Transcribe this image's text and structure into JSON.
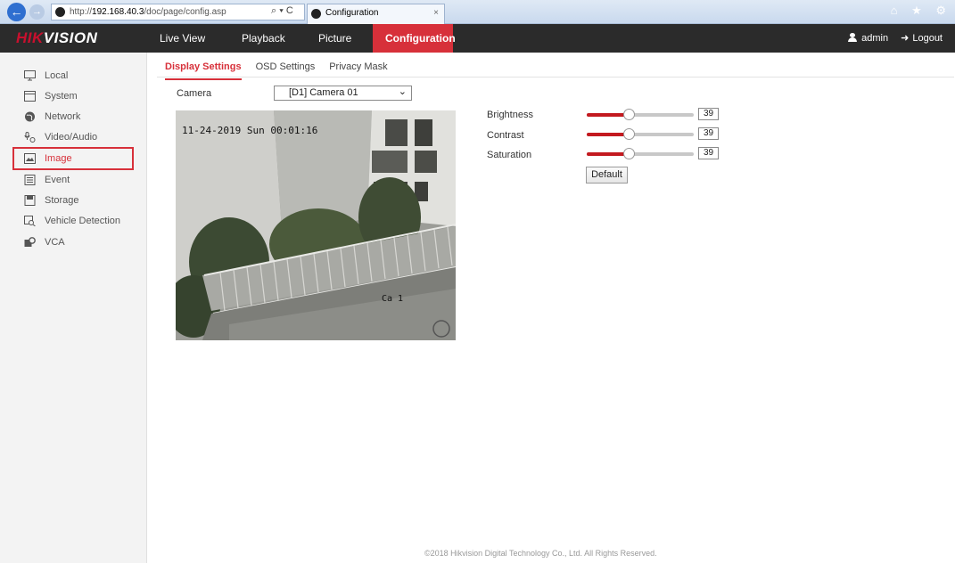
{
  "browser": {
    "url_prefix": "http://",
    "url_host": "192.168.40.3",
    "url_path": "/doc/page/config.asp",
    "addr_actions": "⌕ ▾ C",
    "tab_title": "Configuration",
    "tab_close": "×",
    "right_icons": "⌂ ★ ⚙"
  },
  "header": {
    "logo_red": "HIK",
    "logo_white": "VISION",
    "nav": [
      {
        "label": "Live View"
      },
      {
        "label": "Playback"
      },
      {
        "label": "Picture"
      },
      {
        "label": "Configuration",
        "active": true
      }
    ],
    "user": "admin",
    "logout": "Logout"
  },
  "sidebar": {
    "items": [
      {
        "label": "Local",
        "icon": "monitor-icon"
      },
      {
        "label": "System",
        "icon": "window-icon"
      },
      {
        "label": "Network",
        "icon": "globe-icon"
      },
      {
        "label": "Video/Audio",
        "icon": "camera-mic-icon"
      },
      {
        "label": "Image",
        "icon": "image-icon",
        "active": true
      },
      {
        "label": "Event",
        "icon": "calendar-icon"
      },
      {
        "label": "Storage",
        "icon": "disk-icon"
      },
      {
        "label": "Vehicle Detection",
        "icon": "vehicle-search-icon"
      },
      {
        "label": "VCA",
        "icon": "vca-icon"
      }
    ]
  },
  "subtabs": [
    {
      "label": "Display Settings",
      "active": true
    },
    {
      "label": "OSD Settings"
    },
    {
      "label": "Privacy Mask"
    }
  ],
  "camera": {
    "label": "Camera",
    "selected": "[D1] Camera 01"
  },
  "video": {
    "osd_time": "11-24-2019 Sun 00:01:16",
    "osd_name": "Ca    1"
  },
  "controls": [
    {
      "label": "Brightness",
      "value": "39",
      "level": 0.39
    },
    {
      "label": "Contrast",
      "value": "39",
      "level": 0.39
    },
    {
      "label": "Saturation",
      "value": "39",
      "level": 0.39
    }
  ],
  "default_button": "Default",
  "footer": "©2018 Hikvision Digital Technology Co., Ltd. All Rights Reserved.",
  "colors": {
    "accent": "#d7303a",
    "header_bg": "#2b2b2b"
  }
}
